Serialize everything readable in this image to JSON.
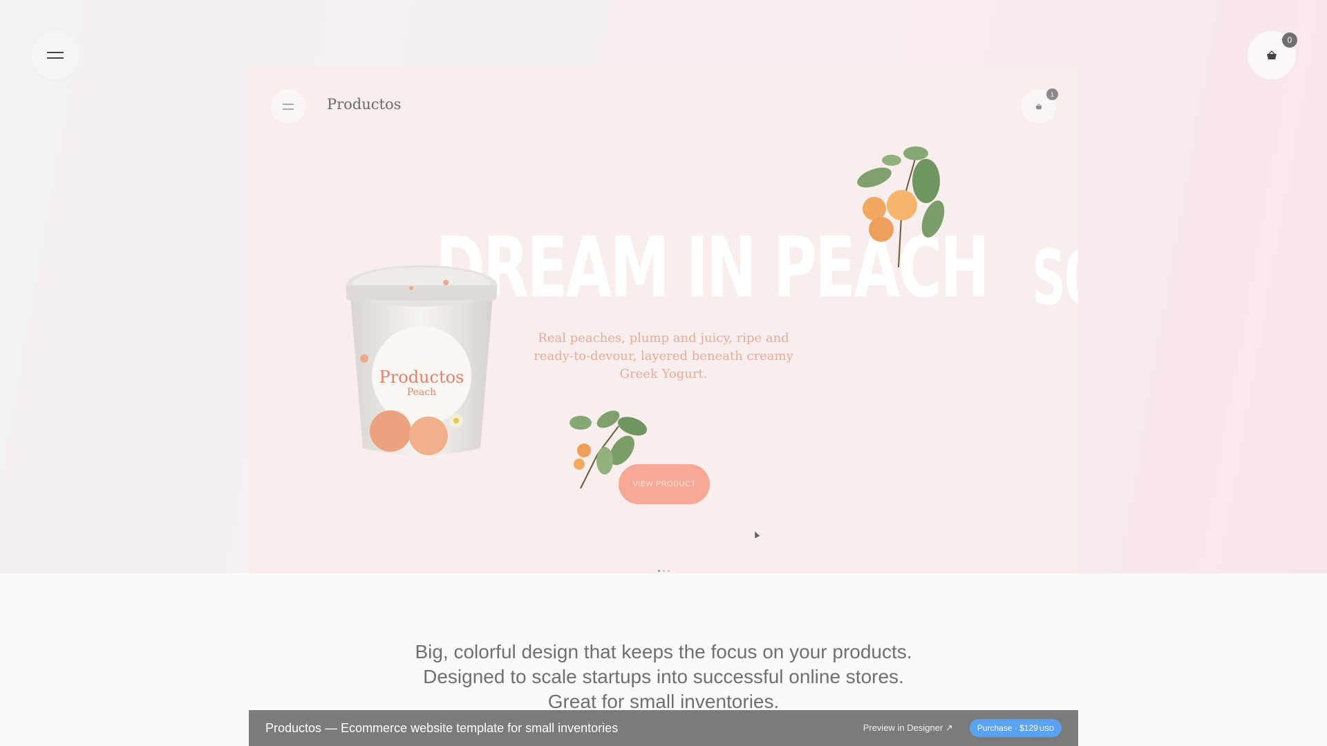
{
  "outer": {
    "menu_icon": "hamburger-icon",
    "cart_icon": "basket-icon",
    "cart_count": "0"
  },
  "preview": {
    "brand": "Productos",
    "menu_icon": "hamburger-icon",
    "cart_icon": "basket-icon",
    "cart_count": "1",
    "headline": "DREAM IN PEACH",
    "next_headline": "SO",
    "lead": "Real peaches, plump and juicy, ripe and ready-to-devour, layered beneath creamy Greek Yogurt.",
    "cta": "VIEW PRODUCT",
    "product_image": "peach-yogurt-tub",
    "decor_images": [
      "peach-branch-top",
      "peach-branch-bottom"
    ],
    "colors": {
      "accent": "#f5a893",
      "lead_text": "#e9aa9a",
      "background": "#f8eeee"
    }
  },
  "tagline": {
    "line1": "Big, colorful design that keeps the focus on your products.",
    "line2": "Designed to scale startups into successful online stores.",
    "line3": "Great for small inventories."
  },
  "bottom_bar": {
    "title": "Productos — Ecommerce website template for small inventories",
    "preview_link": "Preview in Designer ↗",
    "purchase": "Purchase · $129",
    "currency": "USD",
    "colors": {
      "bar": "#7b7b7b",
      "button": "#5aa2f2"
    }
  }
}
